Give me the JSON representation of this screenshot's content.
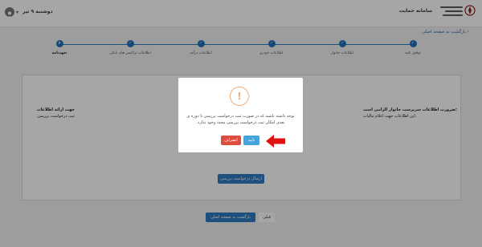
{
  "header": {
    "system_name": "سامانه حمایت",
    "date": "دوشنبه ۹ تیر"
  },
  "back_link": "‹ بازگشت به صفحه اصلی",
  "stepper": {
    "steps": [
      {
        "label": "توافق نامه",
        "done": true
      },
      {
        "label": "اطلاعات خانوار",
        "done": true
      },
      {
        "label": "اطلاعات خودرو",
        "done": true
      },
      {
        "label": "اطلاعات درآمد",
        "done": true
      },
      {
        "label": "اطلاعات تراکنش های بانکی",
        "done": true
      },
      {
        "label": "تعهدنامه",
        "done": false,
        "number": "۶"
      }
    ]
  },
  "content": {
    "line1_right": "جهت ارائه اطلاعات",
    "line2_right": "ثبت درخواست بررسی",
    "line1_left": ":ضرورت اطلاعات سرپرست خانوار الزامی است",
    "line2_left": ".این اطلاعات جهت اعلام مالیات",
    "submit_label": "ارسال درخواست بررسی"
  },
  "footer": {
    "main_button": "بازگشت به صفحه اصلی",
    "prev_button": "قبلی"
  },
  "modal": {
    "icon": "!",
    "message": "توجه داشته باشید که در صورت ثبت درخواست بررسی تا دوره ی بعدی امکان ثبت درخواست بررسی مجدد وجود ندارد.",
    "cancel_label": "انصراف",
    "confirm_label": "تایید"
  },
  "colors": {
    "primary": "#2f7cc1",
    "danger": "#dc4d3f",
    "confirm": "#45a3dd",
    "warning": "#f0ad78",
    "arrow": "#e01010"
  }
}
